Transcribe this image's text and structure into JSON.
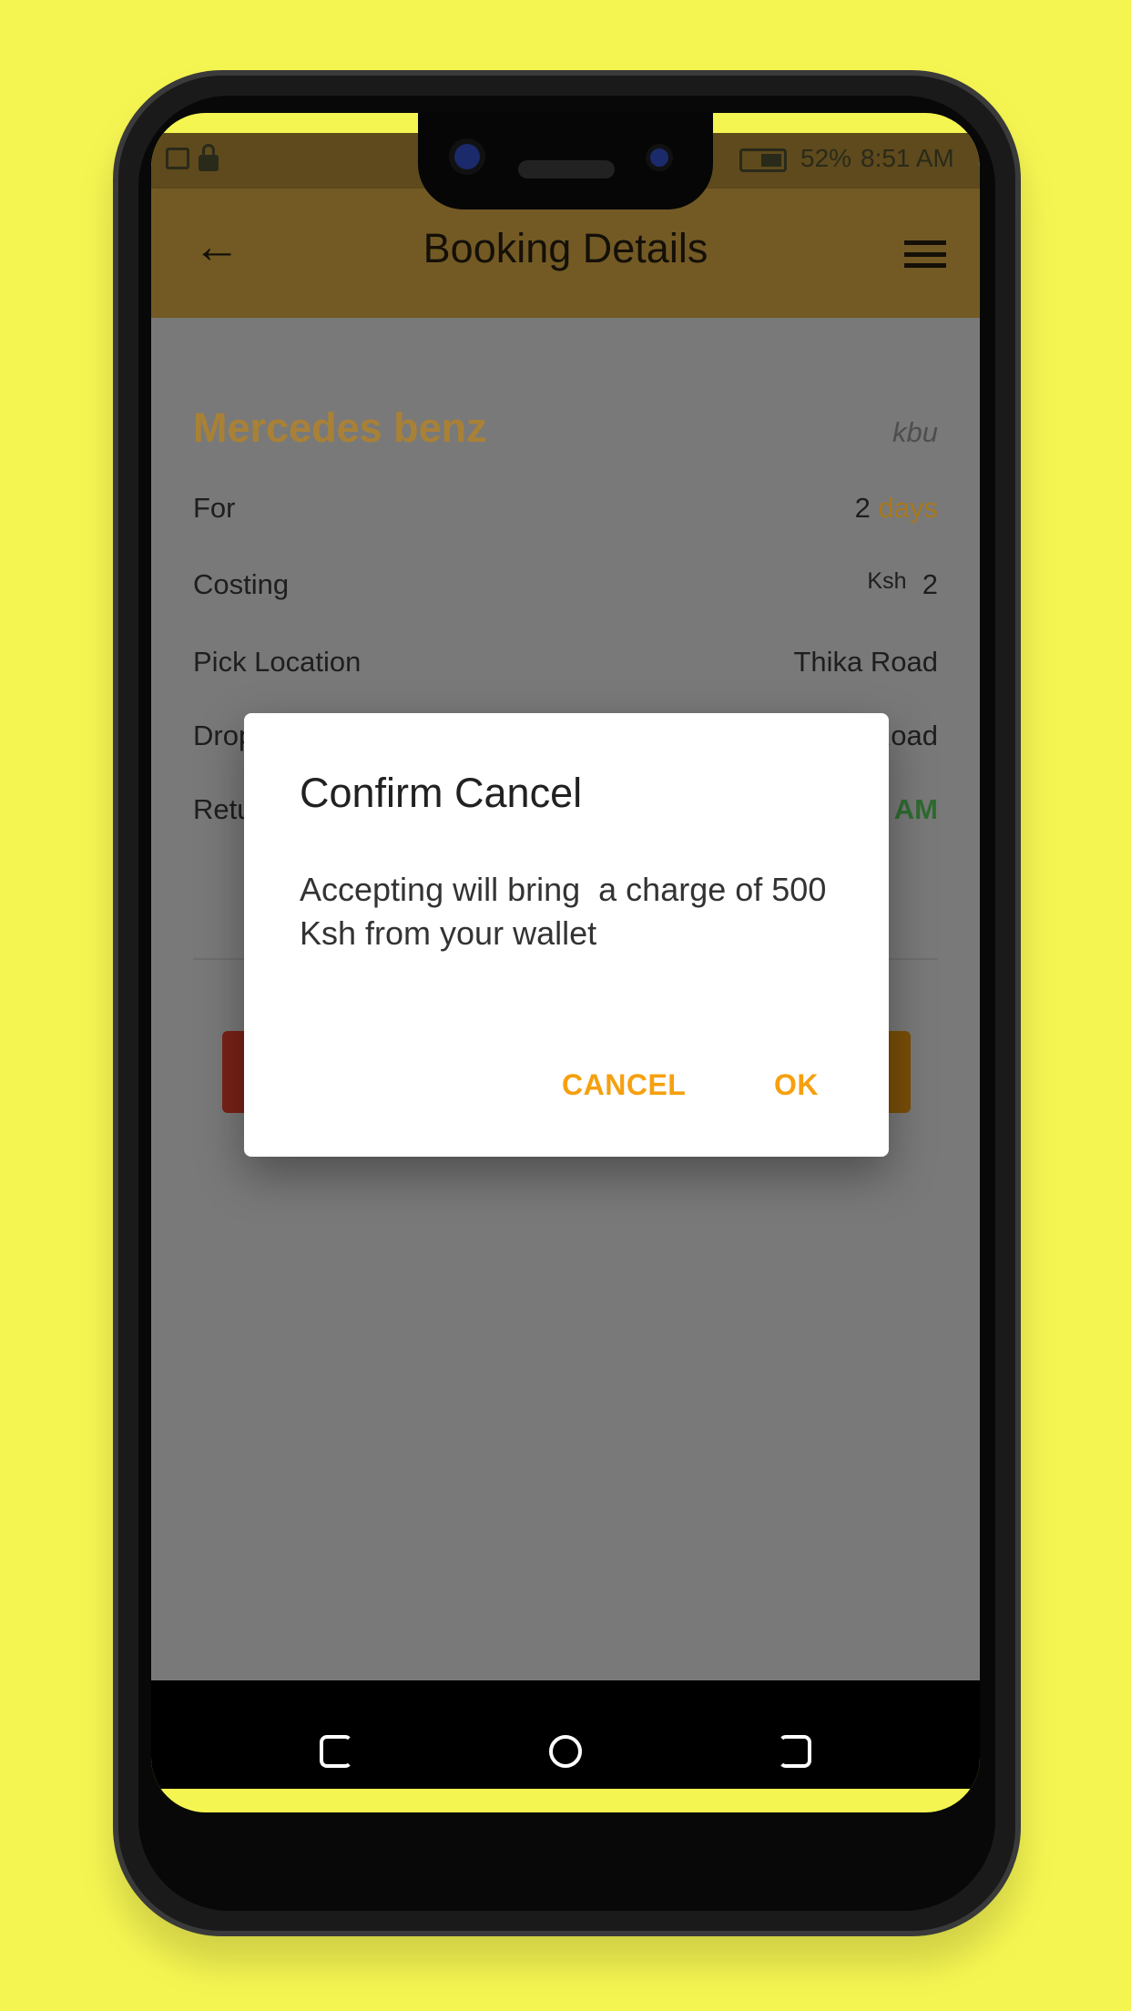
{
  "status_bar": {
    "battery": "52%",
    "time": "8:51 AM",
    "icons": [
      "cast-icon",
      "lock-icon",
      "battery-icon"
    ]
  },
  "app_bar": {
    "title": "Booking Details",
    "back_icon": "arrow-left-icon",
    "menu_icon": "hamburger-menu-icon"
  },
  "booking": {
    "car_name": "Mercedes benz",
    "plate": "kbu",
    "rows": [
      {
        "label": "For",
        "value": "2",
        "unit": "days"
      },
      {
        "label": "Costing",
        "currency": "Ksh",
        "value": "2"
      },
      {
        "label": "Pick Location",
        "value": "Thika Road"
      },
      {
        "label": "Drop Location",
        "value": "Thika Road"
      },
      {
        "label": "Return",
        "value": "AM"
      }
    ]
  },
  "dialog": {
    "title": "Confirm Cancel",
    "message": "Accepting will bring  a charge of 500 Ksh from your wallet",
    "cancel_label": "CANCEL",
    "ok_label": "OK"
  },
  "colors": {
    "accent": "#f5a00f",
    "app_bar": "#735a24",
    "background": "#f5f552",
    "cancel_button": "#c0392b"
  }
}
